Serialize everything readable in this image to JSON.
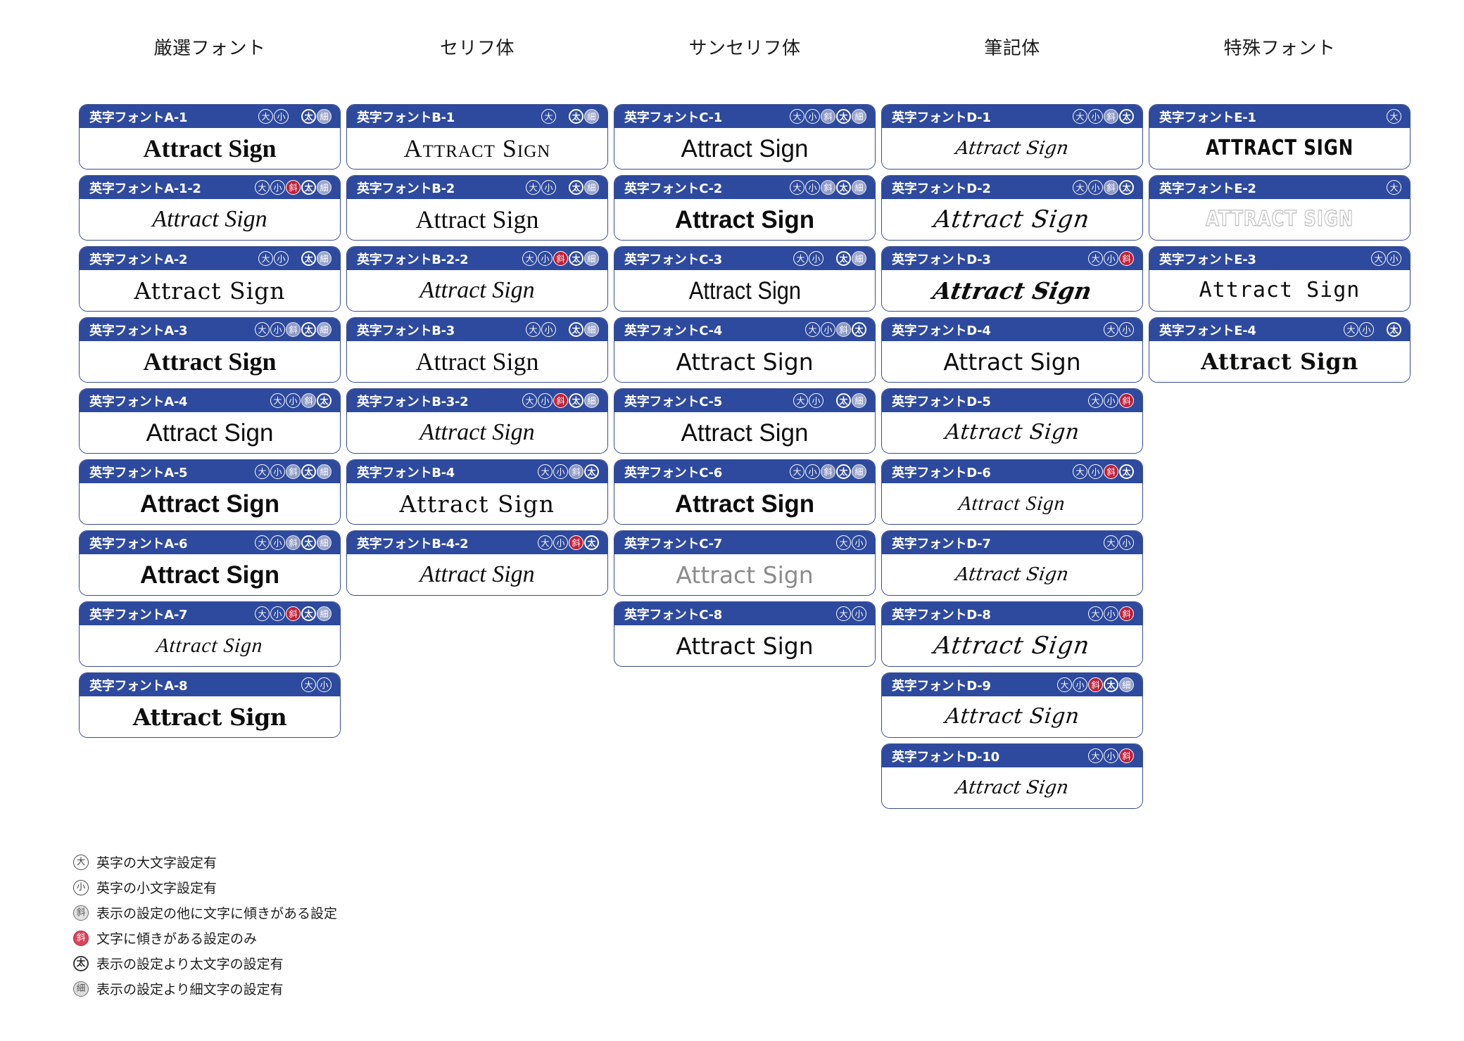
{
  "columns": [
    {
      "header": "厳選フォント",
      "key": "A"
    },
    {
      "header": "セリフ体",
      "key": "B"
    },
    {
      "header": "サンセリフ体",
      "key": "C"
    },
    {
      "header": "筆記体",
      "key": "D"
    },
    {
      "header": "特殊フォント",
      "key": "E"
    }
  ],
  "sample_text_default": "Attract Sign",
  "badge_glyphs": {
    "dai": "大",
    "sho": "小",
    "naname": "斜",
    "naname_red": "斜",
    "futo": "太",
    "hoso": "細"
  },
  "colors": {
    "header_blue": "#2e4a9e",
    "border_blue": "#3a4c8c",
    "badge_red": "#c0213a",
    "badge_gray": "#8f9bc4",
    "card_bg": "#ffffff",
    "text": "#0d0d0d"
  },
  "cards": {
    "A": [
      {
        "id": "英字フォントA-1",
        "sample": "Attract Sign",
        "style": "s-serif-b",
        "badges": [
          "dai",
          "sho",
          "gap",
          "futo",
          "hoso"
        ]
      },
      {
        "id": "英字フォントA-1-2",
        "sample": "Attract Sign",
        "style": "s-serif-i",
        "badges": [
          "dai",
          "sho",
          "naname_red",
          "futo",
          "hoso"
        ]
      },
      {
        "id": "英字フォントA-2",
        "sample": "Attract Sign",
        "style": "s-serif-lt",
        "badges": [
          "dai",
          "sho",
          "gap",
          "futo",
          "hoso"
        ]
      },
      {
        "id": "英字フォントA-3",
        "sample": "Attract Sign",
        "style": "s-serif-b",
        "badges": [
          "dai",
          "sho",
          "naname",
          "futo",
          "hoso"
        ]
      },
      {
        "id": "英字フォントA-4",
        "sample": "Attract Sign",
        "style": "s-sans",
        "badges": [
          "dai",
          "sho",
          "naname",
          "futo"
        ]
      },
      {
        "id": "英字フォントA-5",
        "sample": "Attract Sign",
        "style": "s-sans-b",
        "badges": [
          "dai",
          "sho",
          "naname",
          "futo",
          "hoso"
        ]
      },
      {
        "id": "英字フォントA-6",
        "sample": "Attract Sign",
        "style": "s-sans-b",
        "badges": [
          "dai",
          "sho",
          "naname",
          "futo",
          "hoso"
        ]
      },
      {
        "id": "英字フォントA-7",
        "sample": "Attract Sign",
        "style": "s-script-fine",
        "badges": [
          "dai",
          "sho",
          "naname_red",
          "futo",
          "hoso"
        ]
      },
      {
        "id": "英字フォントA-8",
        "sample": "Attract Sign",
        "style": "s-blackletter",
        "badges": [
          "dai",
          "sho"
        ]
      }
    ],
    "B": [
      {
        "id": "英字フォントB-1",
        "sample": "Attract Sign",
        "style": "s-serif-sc",
        "badges": [
          "dai",
          "gap",
          "futo",
          "hoso"
        ]
      },
      {
        "id": "英字フォントB-2",
        "sample": "Attract Sign",
        "style": "s-serif",
        "badges": [
          "dai",
          "sho",
          "gap",
          "futo",
          "hoso"
        ]
      },
      {
        "id": "英字フォントB-2-2",
        "sample": "Attract Sign",
        "style": "s-serif-i",
        "badges": [
          "dai",
          "sho",
          "naname_red",
          "futo",
          "hoso"
        ]
      },
      {
        "id": "英字フォントB-3",
        "sample": "Attract Sign",
        "style": "s-serif",
        "badges": [
          "dai",
          "sho",
          "gap",
          "futo",
          "hoso"
        ]
      },
      {
        "id": "英字フォントB-3-2",
        "sample": "Attract Sign",
        "style": "s-serif-i",
        "badges": [
          "dai",
          "sho",
          "naname_red",
          "futo",
          "hoso"
        ]
      },
      {
        "id": "英字フォントB-4",
        "sample": "Attract Sign",
        "style": "s-serif-wide",
        "badges": [
          "dai",
          "sho",
          "naname",
          "futo"
        ]
      },
      {
        "id": "英字フォントB-4-2",
        "sample": "Attract Sign",
        "style": "s-serif-i",
        "badges": [
          "dai",
          "sho",
          "naname_red",
          "futo"
        ]
      }
    ],
    "C": [
      {
        "id": "英字フォントC-1",
        "sample": "Attract Sign",
        "style": "s-sans",
        "badges": [
          "dai",
          "sho",
          "naname",
          "futo",
          "hoso"
        ]
      },
      {
        "id": "英字フォントC-2",
        "sample": "Attract Sign",
        "style": "s-sans-b",
        "badges": [
          "dai",
          "sho",
          "naname",
          "futo",
          "hoso"
        ]
      },
      {
        "id": "英字フォントC-3",
        "sample": "Attract Sign",
        "style": "s-sans-cond",
        "badges": [
          "dai",
          "sho",
          "gap",
          "futo",
          "hoso"
        ]
      },
      {
        "id": "英字フォントC-4",
        "sample": "Attract Sign",
        "style": "s-sans-dj",
        "badges": [
          "dai",
          "sho",
          "naname",
          "futo"
        ]
      },
      {
        "id": "英字フォントC-5",
        "sample": "Attract Sign",
        "style": "s-sans",
        "badges": [
          "dai",
          "sho",
          "gap",
          "futo",
          "hoso"
        ]
      },
      {
        "id": "英字フォントC-6",
        "sample": "Attract Sign",
        "style": "s-sans-b",
        "badges": [
          "dai",
          "sho",
          "naname",
          "futo",
          "hoso"
        ]
      },
      {
        "id": "英字フォントC-7",
        "sample": "Attract Sign",
        "style": "s-sans-light",
        "badges": [
          "dai",
          "sho"
        ]
      },
      {
        "id": "英字フォントC-8",
        "sample": "Attract Sign",
        "style": "s-sans-dj",
        "badges": [
          "dai",
          "sho"
        ]
      }
    ],
    "D": [
      {
        "id": "英字フォントD-1",
        "sample": "Attract Sign",
        "style": "s-script-sm",
        "badges": [
          "dai",
          "sho",
          "naname",
          "futo"
        ]
      },
      {
        "id": "英字フォントD-2",
        "sample": "Attract Sign",
        "style": "s-script-lg",
        "badges": [
          "dai",
          "sho",
          "naname",
          "futo"
        ]
      },
      {
        "id": "英字フォントD-3",
        "sample": "Attract Sign",
        "style": "s-script-bd",
        "badges": [
          "dai",
          "sho",
          "naname_red"
        ]
      },
      {
        "id": "英字フォントD-4",
        "sample": "Attract Sign",
        "style": "s-sans-dj",
        "badges": [
          "dai",
          "sho"
        ]
      },
      {
        "id": "英字フォントD-5",
        "sample": "Attract Sign",
        "style": "s-script",
        "badges": [
          "dai",
          "sho",
          "naname_red"
        ]
      },
      {
        "id": "英字フォントD-6",
        "sample": "Attract Sign",
        "style": "s-script-fine",
        "badges": [
          "dai",
          "sho",
          "naname_red",
          "futo"
        ]
      },
      {
        "id": "英字フォントD-7",
        "sample": "Attract Sign",
        "style": "s-script-sm",
        "badges": [
          "dai",
          "sho"
        ]
      },
      {
        "id": "英字フォントD-8",
        "sample": "Attract Sign",
        "style": "s-script-lg",
        "badges": [
          "dai",
          "sho",
          "naname_red"
        ]
      },
      {
        "id": "英字フォントD-9",
        "sample": "Attract Sign",
        "style": "s-script",
        "badges": [
          "dai",
          "sho",
          "naname_red",
          "futo",
          "hoso"
        ]
      },
      {
        "id": "英字フォントD-10",
        "sample": "Attract Sign",
        "style": "s-script-sm",
        "badges": [
          "dai",
          "sho",
          "naname_red"
        ]
      }
    ],
    "E": [
      {
        "id": "英字フォントE-1",
        "sample": "ATTRACT SIGN",
        "style": "s-black",
        "badges": [
          "dai"
        ]
      },
      {
        "id": "英字フォントE-2",
        "sample": "ATTRACT SIGN",
        "style": "s-outline",
        "badges": [
          "dai"
        ]
      },
      {
        "id": "英字フォントE-3",
        "sample": "Attract Sign",
        "style": "s-mono-wide",
        "badges": [
          "dai",
          "sho"
        ]
      },
      {
        "id": "英字フォントE-4",
        "sample": "Attract Sign",
        "style": "s-deco",
        "badges": [
          "dai",
          "sho",
          "gap",
          "futo"
        ]
      }
    ]
  },
  "legend": [
    {
      "badge": "dai",
      "glyph": "大",
      "text": "英字の大文字設定有"
    },
    {
      "badge": "sho",
      "glyph": "小",
      "text": "英字の小文字設定有"
    },
    {
      "badge": "naname",
      "glyph": "斜",
      "text": "表示の設定の他に文字に傾きがある設定"
    },
    {
      "badge": "naname_red",
      "glyph": "斜",
      "text": "文字に傾きがある設定のみ"
    },
    {
      "badge": "futo",
      "glyph": "太",
      "text": "表示の設定より太文字の設定有"
    },
    {
      "badge": "hoso",
      "glyph": "細",
      "text": "表示の設定より細文字の設定有"
    }
  ]
}
